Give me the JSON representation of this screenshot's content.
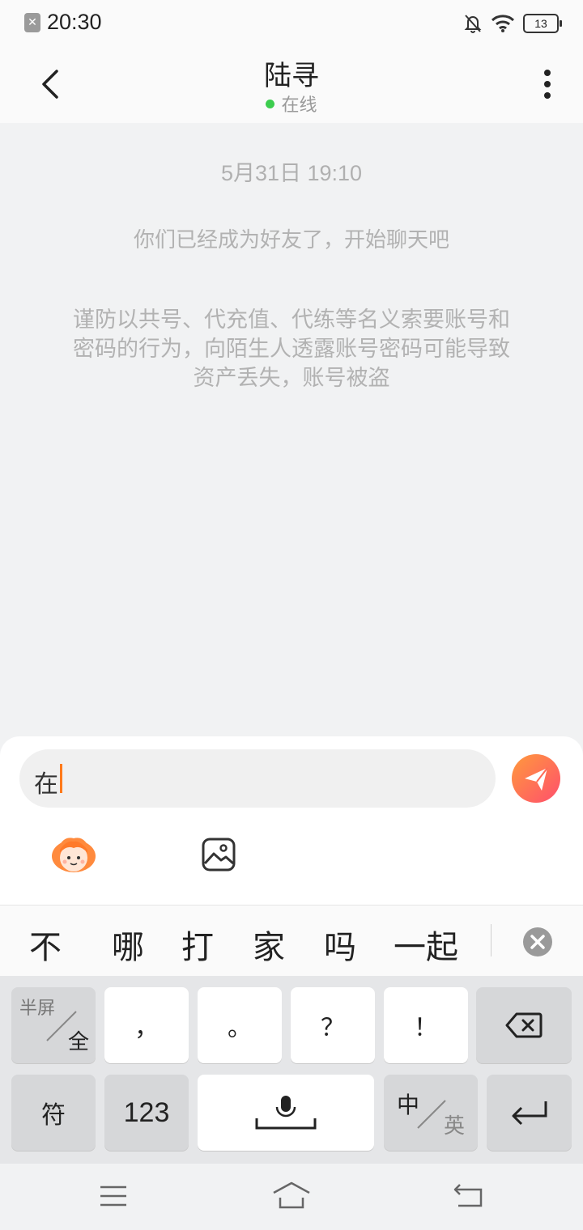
{
  "status_bar": {
    "time": "20:30",
    "battery": "13"
  },
  "header": {
    "title": "陆寻",
    "status": "在线"
  },
  "chat": {
    "timestamp": "5月31日 19:10",
    "friend_notice": "你们已经成为好友了，开始聊天吧",
    "warning_lines": [
      "谨防以共号、代充值、代练等名义索要账号和",
      "密码的行为，向陌生人透露账号密码可能导致",
      "资产丢失，账号被盗"
    ]
  },
  "input": {
    "value": "在"
  },
  "candidates": [
    "不",
    "哪",
    "打",
    "家",
    "吗",
    "一起"
  ],
  "keyboard": {
    "half_full_top": "半屏",
    "half_full_bottom": "全",
    "comma": "，",
    "period": "。",
    "question": "？",
    "exclaim": "！",
    "symbols": "符",
    "numbers": "123",
    "lang_top": "中",
    "lang_bottom": "英"
  },
  "colors": {
    "accent_orange": "#ff7a1a",
    "online_green": "#3ccd4e",
    "send_gradient_start": "#ff9a3c",
    "send_gradient_end": "#ff4f6d"
  }
}
